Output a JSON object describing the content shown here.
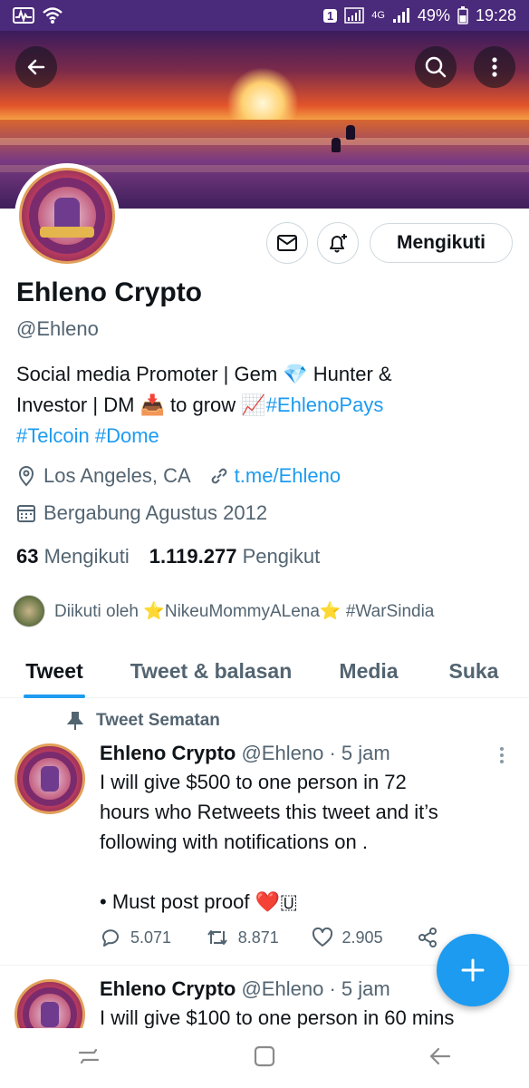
{
  "status_bar": {
    "sim_badge": "1",
    "network": "4G",
    "battery": "49%",
    "time": "19:28"
  },
  "profile": {
    "name": "Ehleno Crypto",
    "handle": "@Ehleno",
    "follow_button": "Mengikuti",
    "bio_line1": "Social media Promoter | Gem 💎 Hunter &",
    "bio_line2_a": "Investor | DM 📥 to grow 📈",
    "bio_tag1": "#EhlenoPays",
    "bio_tag2": "#Telcoin",
    "bio_tag3": "#Dome",
    "location": "Los Angeles, CA",
    "link": "t.me/Ehleno",
    "joined": "Bergabung Agustus 2012",
    "following_count": "63",
    "following_label": "Mengikuti",
    "followers_count": "1.119.277",
    "followers_label": "Pengikut",
    "followed_by": "Diikuti oleh ⭐NikeuMommyALena⭐ #WarSindia"
  },
  "tabs": [
    "Tweet",
    "Tweet & balasan",
    "Media",
    "Suka"
  ],
  "pinned_label": "Tweet Sematan",
  "tweets": [
    {
      "name": "Ehleno Crypto",
      "handle": "@Ehleno",
      "time": "· 5 jam",
      "line1": "I will give $500 to one person in 72",
      "line2": "hours who Retweets this tweet and it’s",
      "line3": "following with notifications on .",
      "line4": "• Must post proof ❤️",
      "line4_tail": "🇺",
      "replies": "5.071",
      "retweets": "8.871",
      "likes": "2.905"
    },
    {
      "name": "Ehleno Crypto",
      "handle": "@Ehleno",
      "time": "· 5 jam",
      "line1": "I will give $100 to one person in 60 mins"
    }
  ],
  "colors": {
    "accent": "#1d9bf0",
    "secondary_text": "#536471",
    "status_bar": "#4a2a7a"
  }
}
